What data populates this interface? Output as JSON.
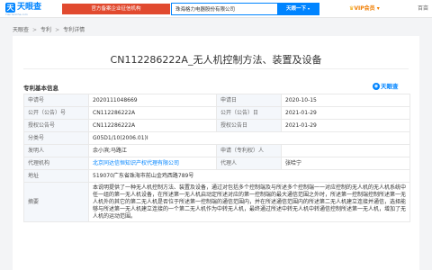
{
  "topbar": {
    "logo_char": "天",
    "logo_text": "天眼查",
    "logo_sub": "TianYanCha.com",
    "official_text": "官方备案企业征信机构",
    "search_value": "珠海格力电器股份有限公司",
    "search_button": "天眼一下",
    "vip_label": "VIP会员",
    "more_label": "百亩"
  },
  "breadcrumb": [
    "天眼查",
    "专利",
    "专利详情"
  ],
  "page_title": "CN112286222A_无人机控制方法、装置及设备",
  "section_title": "专利基本信息",
  "brand_label": "天眼查",
  "patent": {
    "app_no_label": "申请号",
    "app_no": "2020111048669",
    "app_date_label": "申请日",
    "app_date": "2020-10-15",
    "pub_no_label": "公开（公告）号",
    "pub_no": "CN112286222A",
    "pub_date_label": "公开（公告）日",
    "pub_date": "2021-01-29",
    "grant_no_label": "授权公告号",
    "grant_no": "CN112286222A",
    "grant_date_label": "授权公告日",
    "grant_date": "2021-01-29",
    "ipc_label": "分类号",
    "ipc": "G05D1/10(2006.01)I",
    "inventor_label": "发明人",
    "inventor": "余小滨;马路江",
    "applicant_label": "申请（专利权）人",
    "applicant": "",
    "agency_label": "代理机构",
    "agency": "北京同达信恒知识产权代理有限公司",
    "agent_label": "代理人",
    "agent": "张哈宁",
    "address_label": "地址",
    "address": "519070广东省珠海市前山金鸡西路789号",
    "abstract_label": "摘要",
    "abstract": "本说明提供了一种无人机控制方法、装置及设备，通过对包括多个控制端及与所述多个控制端一一对应控制的无人机的无人机系统中任一组的第一无人机设备，在所述第一无人机启动定所述对应的第一控制端的最大通信范围之外时，所述第一控制端控制所述第一无人机外的其它的第二无人机是否位于所述第一控制端的通信范围内，并在所述通信范围内的所述第二无人机建立连接并通信，选择能够与所述第一无人机建立连接的一个第二无人机作为中转无人机，最终通过所述中转无人机中转通信控制所述第一无人机，增加了无人机的运动范围。"
  }
}
